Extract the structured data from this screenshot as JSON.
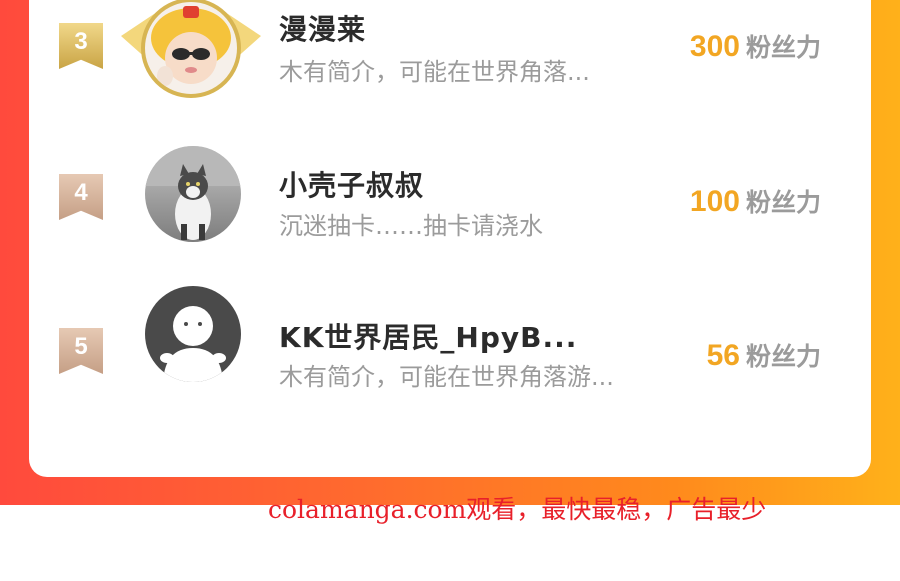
{
  "ranking": {
    "entries": [
      {
        "rank": "3",
        "name": "漫漫莱",
        "bio": "木有简介，可能在世界角落...",
        "score": "300",
        "unit": "粉丝力",
        "avatar_icon": "user-photo-avatar",
        "badge_color": "#d7b553"
      },
      {
        "rank": "4",
        "name": "小壳子叔叔",
        "bio": "沉迷抽卡……抽卡请浇水",
        "score": "100",
        "unit": "粉丝力",
        "avatar_icon": "cat-photo-avatar",
        "badge_color": "#c59f86"
      },
      {
        "rank": "5",
        "name": "KK世界居民_HpyB...",
        "bio": "木有简介，可能在世界角落游...",
        "score": "56",
        "unit": "粉丝力",
        "avatar_icon": "default-user-avatar",
        "badge_color": "#c59f86"
      }
    ]
  },
  "colors": {
    "accent_score": "#f2a623",
    "background_gradient_start": "#ff4a3d",
    "background_gradient_end": "#ffb11a",
    "watermark": "#e8202a"
  },
  "watermark": {
    "text": "colamanga.com观看，最快最稳，广告最少"
  }
}
